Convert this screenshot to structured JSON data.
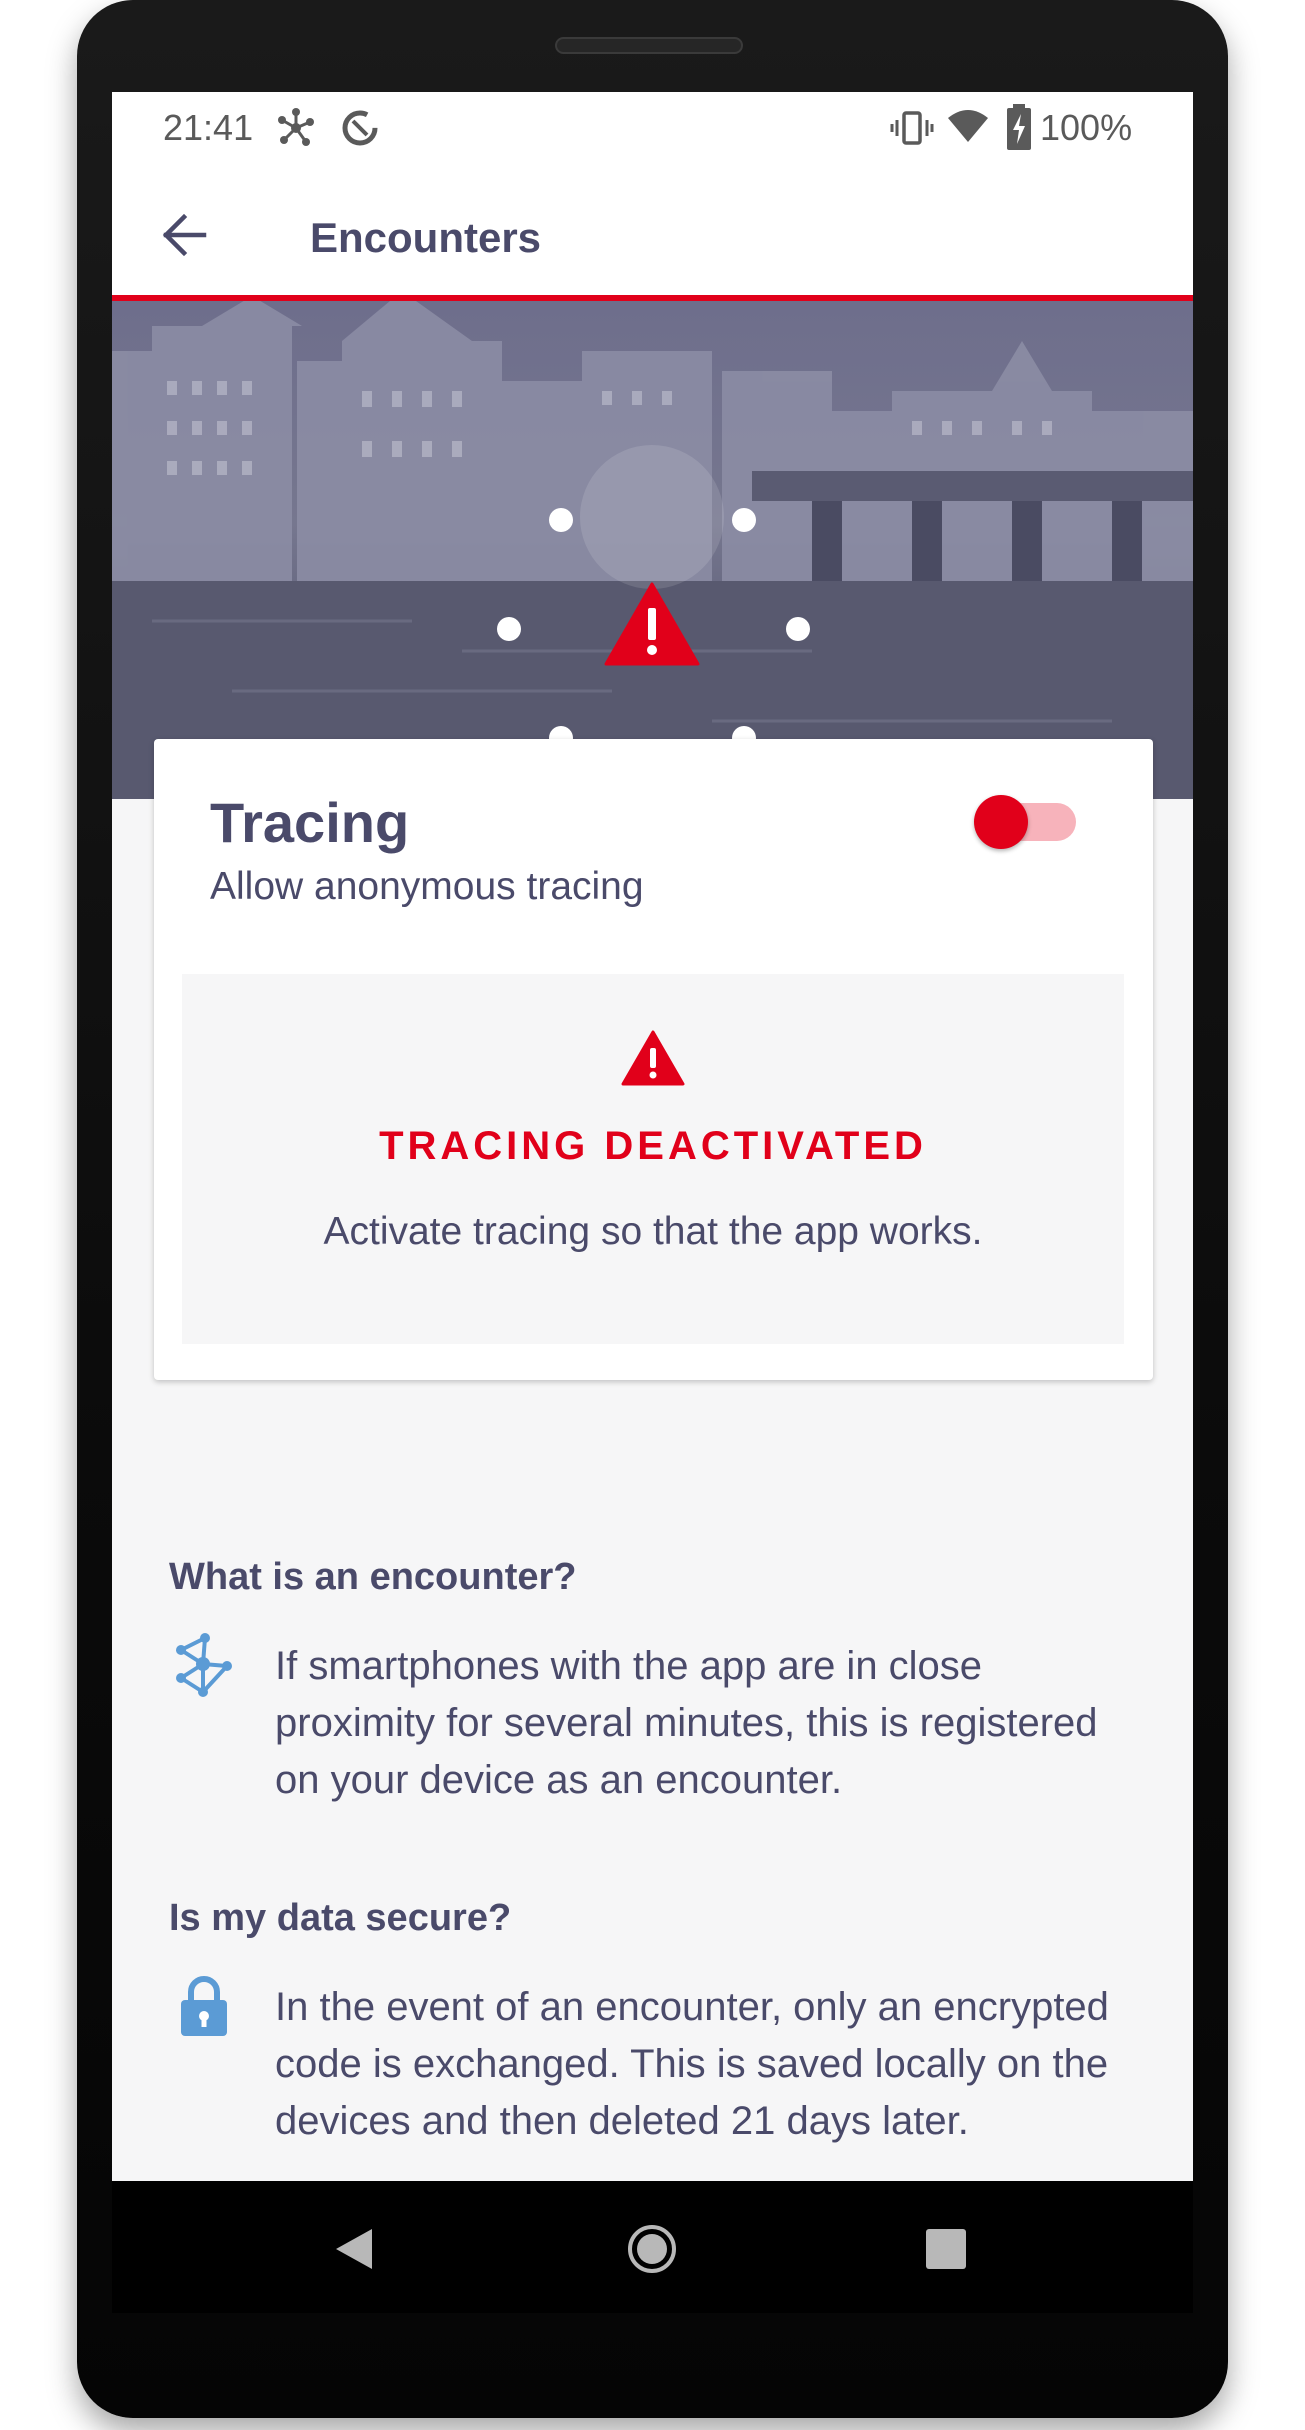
{
  "status_bar": {
    "time": "21:41",
    "battery": "100%",
    "left_icons": [
      "tracing-network-icon",
      "data-saver-icon"
    ],
    "right_icons": [
      "vibrate-icon",
      "wifi-icon",
      "battery-charging-icon"
    ]
  },
  "app_bar": {
    "title": "Encounters",
    "back_icon": "arrow-left-icon"
  },
  "tracing_card": {
    "title": "Tracing",
    "subtitle": "Allow anonymous tracing",
    "toggle_on": false,
    "warning_title": "TRACING DEACTIVATED",
    "warning_text": "Activate tracing so that the app works."
  },
  "info": [
    {
      "heading": "What is an encounter?",
      "icon": "network-icon",
      "text": "If smartphones with the app are in close proximity for several minutes, this is registered on your device as an encounter."
    },
    {
      "heading": "Is my data secure?",
      "icon": "lock-icon",
      "text": "In the event of an encounter, only an encrypted code is exchanged. This is saved locally on the devices and then deleted 21 days later."
    }
  ],
  "colors": {
    "accent": "#e1001a",
    "text": "#4a4a6a",
    "icon_blue": "#5b9bd5",
    "background": "#f6f6f7"
  },
  "nav_bar": {
    "icons": [
      "back-triangle-icon",
      "home-circle-icon",
      "recents-square-icon"
    ]
  }
}
